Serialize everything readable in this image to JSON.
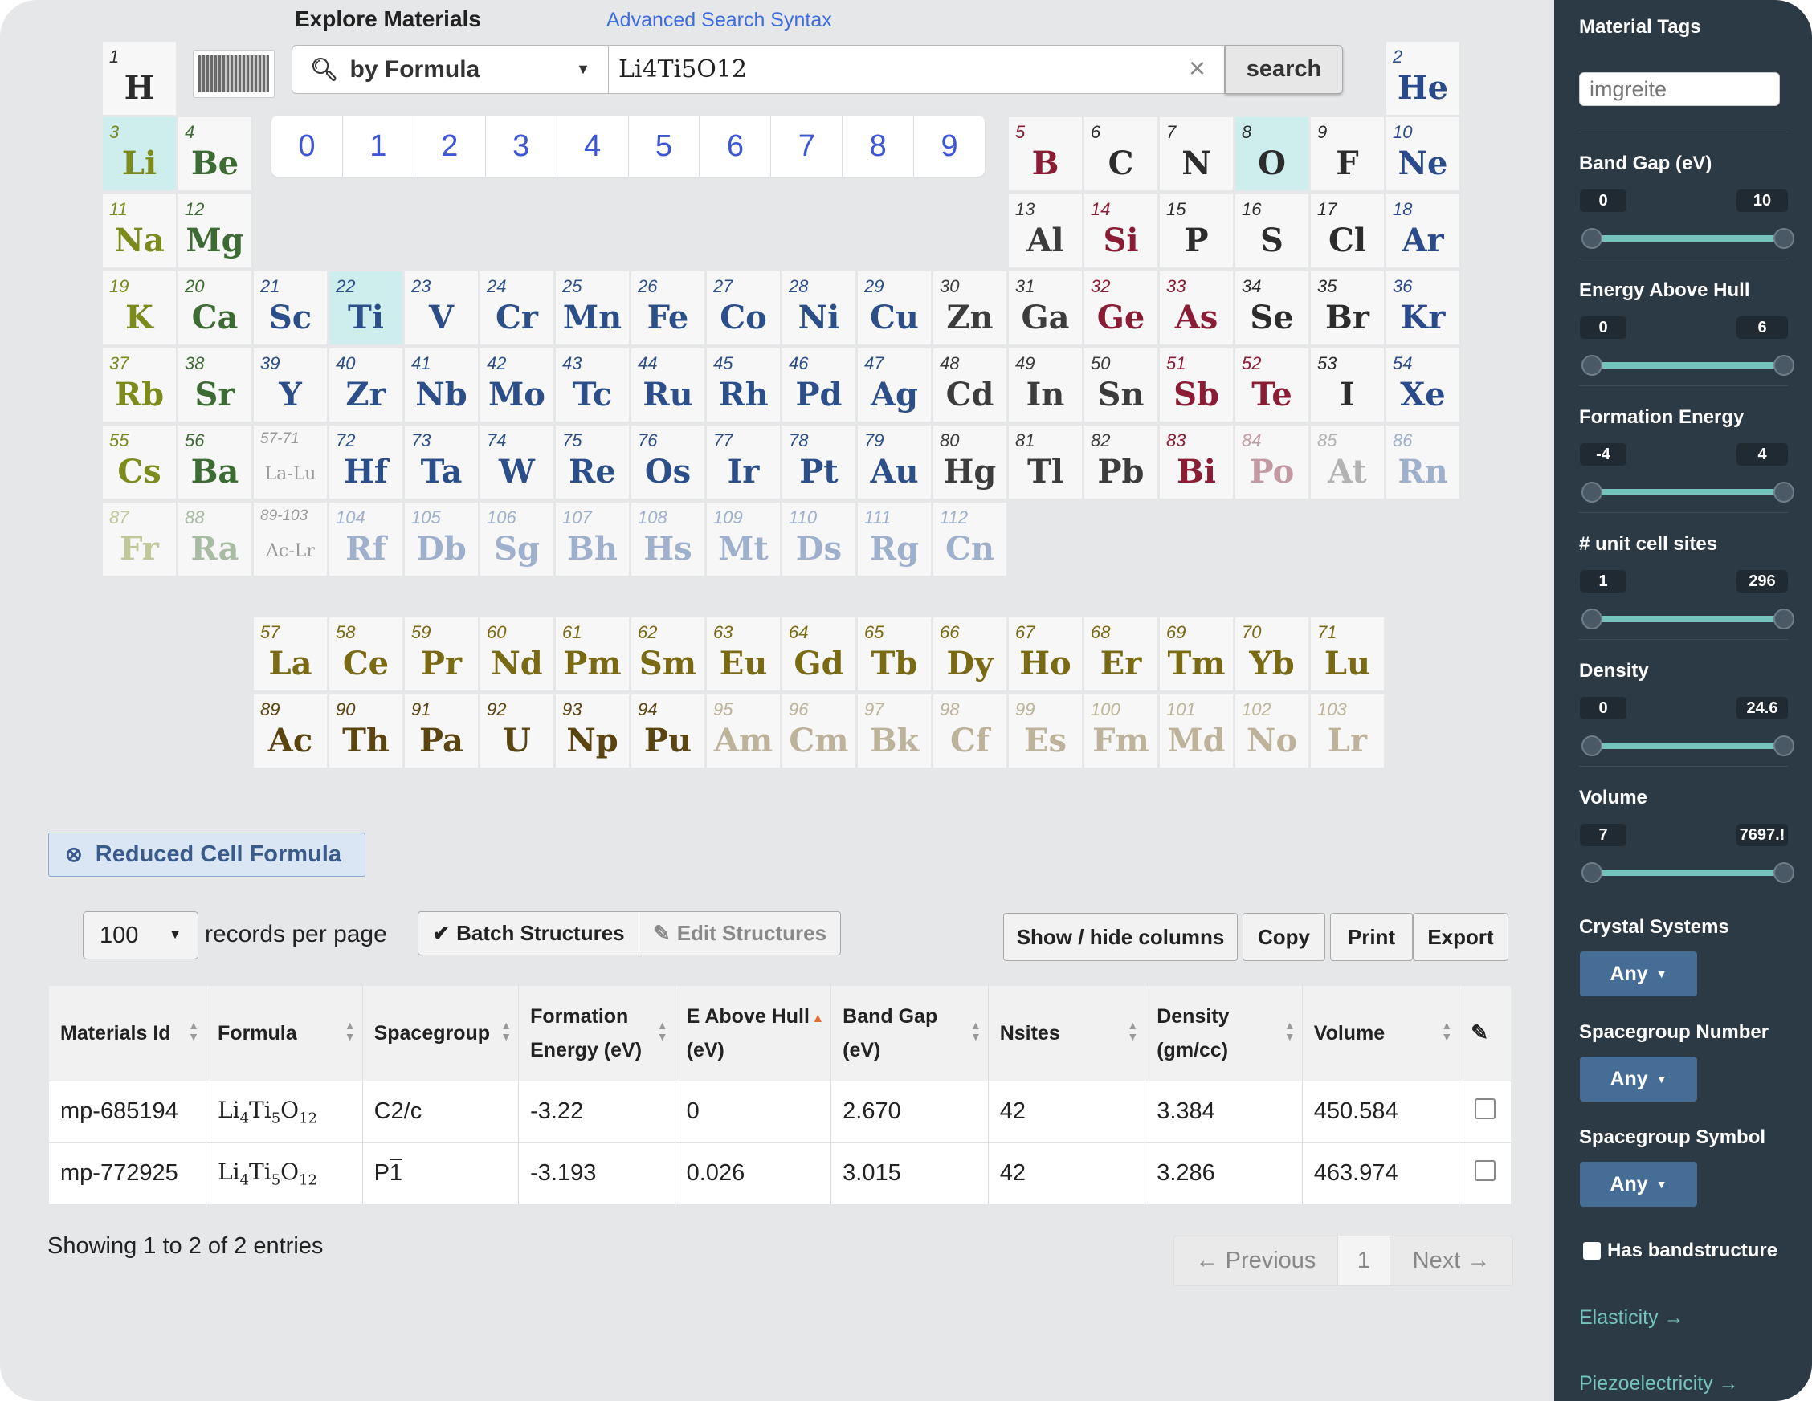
{
  "header": {
    "title": "Explore Materials",
    "advanced_link": "Advanced Search Syntax"
  },
  "search": {
    "type_label": "by Formula",
    "value": "Li4Ti5O12",
    "clear": "×",
    "button": "search"
  },
  "numbers": [
    "0",
    "1",
    "2",
    "3",
    "4",
    "5",
    "6",
    "7",
    "8",
    "9"
  ],
  "colors": {
    "selected_cell": "#cdeeed",
    "sidebar_bg": "#2c3a46",
    "accent": "#74c4bd",
    "any_button": "#466d96"
  },
  "elements": [
    {
      "z": "1",
      "s": "H",
      "r": 0,
      "c": 0,
      "col": "#2c2c2c"
    },
    {
      "z": "2",
      "s": "He",
      "r": 0,
      "c": 17,
      "col": "#2b4a8c"
    },
    {
      "z": "3",
      "s": "Li",
      "r": 1,
      "c": 0,
      "col": "#7d8a1c",
      "sel": true
    },
    {
      "z": "4",
      "s": "Be",
      "r": 1,
      "c": 1,
      "col": "#3d6b34"
    },
    {
      "z": "5",
      "s": "B",
      "r": 1,
      "c": 12,
      "col": "#8a1c34"
    },
    {
      "z": "6",
      "s": "C",
      "r": 1,
      "c": 13,
      "col": "#2c2c2c"
    },
    {
      "z": "7",
      "s": "N",
      "r": 1,
      "c": 14,
      "col": "#2c2c2c"
    },
    {
      "z": "8",
      "s": "O",
      "r": 1,
      "c": 15,
      "col": "#2c2c2c",
      "sel": true
    },
    {
      "z": "9",
      "s": "F",
      "r": 1,
      "c": 16,
      "col": "#2c2c2c"
    },
    {
      "z": "10",
      "s": "Ne",
      "r": 1,
      "c": 17,
      "col": "#2b4a8c"
    },
    {
      "z": "11",
      "s": "Na",
      "r": 2,
      "c": 0,
      "col": "#7d8a1c"
    },
    {
      "z": "12",
      "s": "Mg",
      "r": 2,
      "c": 1,
      "col": "#3d6b34"
    },
    {
      "z": "13",
      "s": "Al",
      "r": 2,
      "c": 12,
      "col": "#3c3c3c"
    },
    {
      "z": "14",
      "s": "Si",
      "r": 2,
      "c": 13,
      "col": "#8a1c34"
    },
    {
      "z": "15",
      "s": "P",
      "r": 2,
      "c": 14,
      "col": "#2c2c2c"
    },
    {
      "z": "16",
      "s": "S",
      "r": 2,
      "c": 15,
      "col": "#2c2c2c"
    },
    {
      "z": "17",
      "s": "Cl",
      "r": 2,
      "c": 16,
      "col": "#2c2c2c"
    },
    {
      "z": "18",
      "s": "Ar",
      "r": 2,
      "c": 17,
      "col": "#2b4a8c"
    },
    {
      "z": "19",
      "s": "K",
      "r": 3,
      "c": 0,
      "col": "#7d8a1c"
    },
    {
      "z": "20",
      "s": "Ca",
      "r": 3,
      "c": 1,
      "col": "#3d6b34"
    },
    {
      "z": "21",
      "s": "Sc",
      "r": 3,
      "c": 2,
      "col": "#2c4f8a"
    },
    {
      "z": "22",
      "s": "Ti",
      "r": 3,
      "c": 3,
      "col": "#2c4f8a",
      "sel": true
    },
    {
      "z": "23",
      "s": "V",
      "r": 3,
      "c": 4,
      "col": "#2c4f8a"
    },
    {
      "z": "24",
      "s": "Cr",
      "r": 3,
      "c": 5,
      "col": "#2c4f8a"
    },
    {
      "z": "25",
      "s": "Mn",
      "r": 3,
      "c": 6,
      "col": "#2c4f8a"
    },
    {
      "z": "26",
      "s": "Fe",
      "r": 3,
      "c": 7,
      "col": "#2c4f8a"
    },
    {
      "z": "27",
      "s": "Co",
      "r": 3,
      "c": 8,
      "col": "#2c4f8a"
    },
    {
      "z": "28",
      "s": "Ni",
      "r": 3,
      "c": 9,
      "col": "#2c4f8a"
    },
    {
      "z": "29",
      "s": "Cu",
      "r": 3,
      "c": 10,
      "col": "#2c4f8a"
    },
    {
      "z": "30",
      "s": "Zn",
      "r": 3,
      "c": 11,
      "col": "#3c3c3c"
    },
    {
      "z": "31",
      "s": "Ga",
      "r": 3,
      "c": 12,
      "col": "#3c3c3c"
    },
    {
      "z": "32",
      "s": "Ge",
      "r": 3,
      "c": 13,
      "col": "#8a1c34"
    },
    {
      "z": "33",
      "s": "As",
      "r": 3,
      "c": 14,
      "col": "#8a1c34"
    },
    {
      "z": "34",
      "s": "Se",
      "r": 3,
      "c": 15,
      "col": "#2c2c2c"
    },
    {
      "z": "35",
      "s": "Br",
      "r": 3,
      "c": 16,
      "col": "#2c2c2c"
    },
    {
      "z": "36",
      "s": "Kr",
      "r": 3,
      "c": 17,
      "col": "#2b4a8c"
    },
    {
      "z": "37",
      "s": "Rb",
      "r": 4,
      "c": 0,
      "col": "#7d8a1c"
    },
    {
      "z": "38",
      "s": "Sr",
      "r": 4,
      "c": 1,
      "col": "#3d6b34"
    },
    {
      "z": "39",
      "s": "Y",
      "r": 4,
      "c": 2,
      "col": "#2c4f8a"
    },
    {
      "z": "40",
      "s": "Zr",
      "r": 4,
      "c": 3,
      "col": "#2c4f8a"
    },
    {
      "z": "41",
      "s": "Nb",
      "r": 4,
      "c": 4,
      "col": "#2c4f8a"
    },
    {
      "z": "42",
      "s": "Mo",
      "r": 4,
      "c": 5,
      "col": "#2c4f8a"
    },
    {
      "z": "43",
      "s": "Tc",
      "r": 4,
      "c": 6,
      "col": "#2c4f8a"
    },
    {
      "z": "44",
      "s": "Ru",
      "r": 4,
      "c": 7,
      "col": "#2c4f8a"
    },
    {
      "z": "45",
      "s": "Rh",
      "r": 4,
      "c": 8,
      "col": "#2c4f8a"
    },
    {
      "z": "46",
      "s": "Pd",
      "r": 4,
      "c": 9,
      "col": "#2c4f8a"
    },
    {
      "z": "47",
      "s": "Ag",
      "r": 4,
      "c": 10,
      "col": "#2c4f8a"
    },
    {
      "z": "48",
      "s": "Cd",
      "r": 4,
      "c": 11,
      "col": "#3c3c3c"
    },
    {
      "z": "49",
      "s": "In",
      "r": 4,
      "c": 12,
      "col": "#3c3c3c"
    },
    {
      "z": "50",
      "s": "Sn",
      "r": 4,
      "c": 13,
      "col": "#3c3c3c"
    },
    {
      "z": "51",
      "s": "Sb",
      "r": 4,
      "c": 14,
      "col": "#8a1c34"
    },
    {
      "z": "52",
      "s": "Te",
      "r": 4,
      "c": 15,
      "col": "#8a1c34"
    },
    {
      "z": "53",
      "s": "I",
      "r": 4,
      "c": 16,
      "col": "#2c2c2c"
    },
    {
      "z": "54",
      "s": "Xe",
      "r": 4,
      "c": 17,
      "col": "#2b4a8c"
    },
    {
      "z": "55",
      "s": "Cs",
      "r": 5,
      "c": 0,
      "col": "#7d8a1c"
    },
    {
      "z": "56",
      "s": "Ba",
      "r": 5,
      "c": 1,
      "col": "#3d6b34"
    },
    {
      "z": "57-71",
      "s": "La-Lu",
      "r": 5,
      "c": 2,
      "col": "#9a9a9a",
      "ph": true
    },
    {
      "z": "72",
      "s": "Hf",
      "r": 5,
      "c": 3,
      "col": "#2c4f8a"
    },
    {
      "z": "73",
      "s": "Ta",
      "r": 5,
      "c": 4,
      "col": "#2c4f8a"
    },
    {
      "z": "74",
      "s": "W",
      "r": 5,
      "c": 5,
      "col": "#2c4f8a"
    },
    {
      "z": "75",
      "s": "Re",
      "r": 5,
      "c": 6,
      "col": "#2c4f8a"
    },
    {
      "z": "76",
      "s": "Os",
      "r": 5,
      "c": 7,
      "col": "#2c4f8a"
    },
    {
      "z": "77",
      "s": "Ir",
      "r": 5,
      "c": 8,
      "col": "#2c4f8a"
    },
    {
      "z": "78",
      "s": "Pt",
      "r": 5,
      "c": 9,
      "col": "#2c4f8a"
    },
    {
      "z": "79",
      "s": "Au",
      "r": 5,
      "c": 10,
      "col": "#2c4f8a"
    },
    {
      "z": "80",
      "s": "Hg",
      "r": 5,
      "c": 11,
      "col": "#3c3c3c"
    },
    {
      "z": "81",
      "s": "Tl",
      "r": 5,
      "c": 12,
      "col": "#3c3c3c"
    },
    {
      "z": "82",
      "s": "Pb",
      "r": 5,
      "c": 13,
      "col": "#3c3c3c"
    },
    {
      "z": "83",
      "s": "Bi",
      "r": 5,
      "c": 14,
      "col": "#8a1c34"
    },
    {
      "z": "84",
      "s": "Po",
      "r": 5,
      "c": 15,
      "col": "#c29aa3"
    },
    {
      "z": "85",
      "s": "At",
      "r": 5,
      "c": 16,
      "col": "#b3b3b3"
    },
    {
      "z": "86",
      "s": "Rn",
      "r": 5,
      "c": 17,
      "col": "#9fb0cc"
    },
    {
      "z": "87",
      "s": "Fr",
      "r": 6,
      "c": 0,
      "col": "#c2c79a"
    },
    {
      "z": "88",
      "s": "Ra",
      "r": 6,
      "c": 1,
      "col": "#a8bba3"
    },
    {
      "z": "89-103",
      "s": "Ac-Lr",
      "r": 6,
      "c": 2,
      "col": "#9a9a9a",
      "ph": true
    },
    {
      "z": "104",
      "s": "Rf",
      "r": 6,
      "c": 3,
      "col": "#9fb0cc"
    },
    {
      "z": "105",
      "s": "Db",
      "r": 6,
      "c": 4,
      "col": "#9fb0cc"
    },
    {
      "z": "106",
      "s": "Sg",
      "r": 6,
      "c": 5,
      "col": "#9fb0cc"
    },
    {
      "z": "107",
      "s": "Bh",
      "r": 6,
      "c": 6,
      "col": "#9fb0cc"
    },
    {
      "z": "108",
      "s": "Hs",
      "r": 6,
      "c": 7,
      "col": "#9fb0cc"
    },
    {
      "z": "109",
      "s": "Mt",
      "r": 6,
      "c": 8,
      "col": "#9fb0cc"
    },
    {
      "z": "110",
      "s": "Ds",
      "r": 6,
      "c": 9,
      "col": "#9fb0cc"
    },
    {
      "z": "111",
      "s": "Rg",
      "r": 6,
      "c": 10,
      "col": "#9fb0cc"
    },
    {
      "z": "112",
      "s": "Cn",
      "r": 6,
      "c": 11,
      "col": "#9fb0cc"
    },
    {
      "z": "57",
      "s": "La",
      "r": 7,
      "c": 2,
      "col": "#7a6a14"
    },
    {
      "z": "58",
      "s": "Ce",
      "r": 7,
      "c": 3,
      "col": "#7a6a14"
    },
    {
      "z": "59",
      "s": "Pr",
      "r": 7,
      "c": 4,
      "col": "#7a6a14"
    },
    {
      "z": "60",
      "s": "Nd",
      "r": 7,
      "c": 5,
      "col": "#7a6a14"
    },
    {
      "z": "61",
      "s": "Pm",
      "r": 7,
      "c": 6,
      "col": "#7a6a14"
    },
    {
      "z": "62",
      "s": "Sm",
      "r": 7,
      "c": 7,
      "col": "#7a6a14"
    },
    {
      "z": "63",
      "s": "Eu",
      "r": 7,
      "c": 8,
      "col": "#7a6a14"
    },
    {
      "z": "64",
      "s": "Gd",
      "r": 7,
      "c": 9,
      "col": "#7a6a14"
    },
    {
      "z": "65",
      "s": "Tb",
      "r": 7,
      "c": 10,
      "col": "#7a6a14"
    },
    {
      "z": "66",
      "s": "Dy",
      "r": 7,
      "c": 11,
      "col": "#7a6a14"
    },
    {
      "z": "67",
      "s": "Ho",
      "r": 7,
      "c": 12,
      "col": "#7a6a14"
    },
    {
      "z": "68",
      "s": "Er",
      "r": 7,
      "c": 13,
      "col": "#7a6a14"
    },
    {
      "z": "69",
      "s": "Tm",
      "r": 7,
      "c": 14,
      "col": "#7a6a14"
    },
    {
      "z": "70",
      "s": "Yb",
      "r": 7,
      "c": 15,
      "col": "#7a6a14"
    },
    {
      "z": "71",
      "s": "Lu",
      "r": 7,
      "c": 16,
      "col": "#7a6a14"
    },
    {
      "z": "89",
      "s": "Ac",
      "r": 8,
      "c": 2,
      "col": "#5a4410"
    },
    {
      "z": "90",
      "s": "Th",
      "r": 8,
      "c": 3,
      "col": "#5a4410"
    },
    {
      "z": "91",
      "s": "Pa",
      "r": 8,
      "c": 4,
      "col": "#5a4410"
    },
    {
      "z": "92",
      "s": "U",
      "r": 8,
      "c": 5,
      "col": "#5a4410"
    },
    {
      "z": "93",
      "s": "Np",
      "r": 8,
      "c": 6,
      "col": "#5a4410"
    },
    {
      "z": "94",
      "s": "Pu",
      "r": 8,
      "c": 7,
      "col": "#5a4410"
    },
    {
      "z": "95",
      "s": "Am",
      "r": 8,
      "c": 8,
      "col": "#bcb39a"
    },
    {
      "z": "96",
      "s": "Cm",
      "r": 8,
      "c": 9,
      "col": "#bcb39a"
    },
    {
      "z": "97",
      "s": "Bk",
      "r": 8,
      "c": 10,
      "col": "#bcb39a"
    },
    {
      "z": "98",
      "s": "Cf",
      "r": 8,
      "c": 11,
      "col": "#bcb39a"
    },
    {
      "z": "99",
      "s": "Es",
      "r": 8,
      "c": 12,
      "col": "#bcb39a"
    },
    {
      "z": "100",
      "s": "Fm",
      "r": 8,
      "c": 13,
      "col": "#bcb39a"
    },
    {
      "z": "101",
      "s": "Md",
      "r": 8,
      "c": 14,
      "col": "#bcb39a"
    },
    {
      "z": "102",
      "s": "No",
      "r": 8,
      "c": 15,
      "col": "#bcb39a"
    },
    {
      "z": "103",
      "s": "Lr",
      "r": 8,
      "c": 16,
      "col": "#bcb39a"
    }
  ],
  "filter_chip": {
    "label": "Reduced Cell Formula"
  },
  "table_controls": {
    "per_page_value": "100",
    "per_page_label": "records per page",
    "batch_label": "Batch Structures",
    "edit_label": "Edit Structures",
    "showhide_label": "Show / hide columns",
    "copy_label": "Copy",
    "print_label": "Print",
    "export_label": "Export"
  },
  "table": {
    "headers": [
      {
        "l1": "Materials Id",
        "l2": ""
      },
      {
        "l1": "Formula",
        "l2": ""
      },
      {
        "l1": "Spacegroup",
        "l2": ""
      },
      {
        "l1": "Formation",
        "l2": "Energy (eV)"
      },
      {
        "l1": "E Above Hull",
        "l2": "(eV)"
      },
      {
        "l1": "Band Gap",
        "l2": "(eV)"
      },
      {
        "l1": "Nsites",
        "l2": ""
      },
      {
        "l1": "Density",
        "l2": "(gm/cc)"
      },
      {
        "l1": "Volume",
        "l2": ""
      }
    ],
    "rows": [
      {
        "id": "mp-685194",
        "formula": [
          "Li",
          "4",
          "Ti",
          "5",
          "O",
          "12"
        ],
        "sg": "C2/c",
        "fe": "-3.22",
        "eah": "0",
        "bg": "2.670",
        "ns": "42",
        "den": "3.384",
        "vol": "450.584"
      },
      {
        "id": "mp-772925",
        "formula": [
          "Li",
          "4",
          "Ti",
          "5",
          "O",
          "12"
        ],
        "sg": "P",
        "sg_bar": "1",
        "fe": "-3.193",
        "eah": "0.026",
        "bg": "3.015",
        "ns": "42",
        "den": "3.286",
        "vol": "463.974"
      }
    ],
    "showing": "Showing 1 to 2 of 2 entries",
    "pager": {
      "prev": "← Previous",
      "page": "1",
      "next": "Next →"
    }
  },
  "sidebar": {
    "tags_title": "Material Tags",
    "tags_placeholder": "imgreite",
    "ranges": [
      {
        "label": "Band Gap (eV)",
        "min": "0",
        "max": "10"
      },
      {
        "label": "Energy Above Hull",
        "min": "0",
        "max": "6"
      },
      {
        "label": "Formation Energy",
        "min": "-4",
        "max": "4"
      },
      {
        "label": "# unit cell sites",
        "min": "1",
        "max": "296"
      },
      {
        "label": "Density",
        "min": "0",
        "max": "24.6"
      },
      {
        "label": "Volume",
        "min": "7",
        "max": "7697.!"
      }
    ],
    "dropdowns": [
      {
        "label": "Crystal Systems",
        "value": "Any"
      },
      {
        "label": "Spacegroup Number",
        "value": "Any"
      },
      {
        "label": "Spacegroup Symbol",
        "value": "Any"
      }
    ],
    "bandstructure_label": "Has bandstructure",
    "links": [
      "Elasticity →",
      "Piezoelectricity →"
    ]
  }
}
